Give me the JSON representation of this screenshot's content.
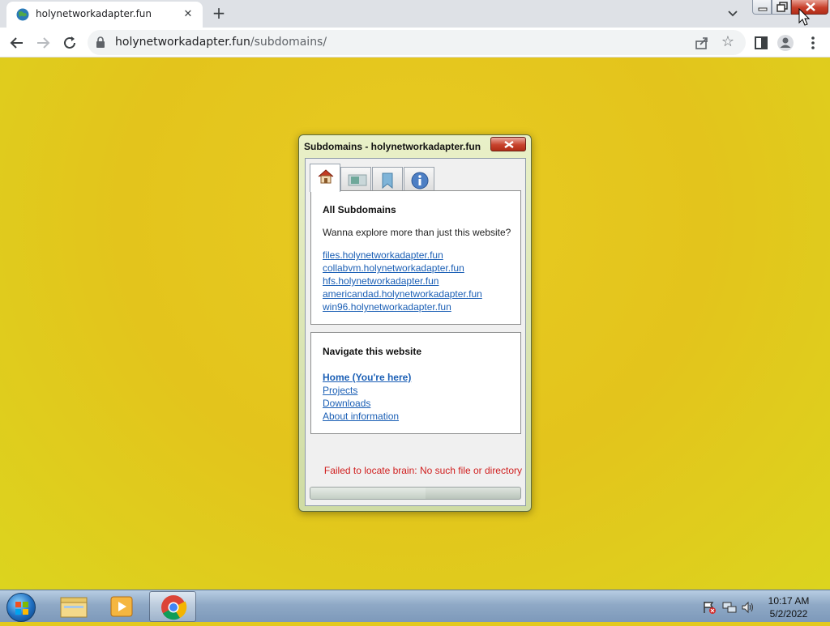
{
  "browser": {
    "tab_title": "holynetworkadapter.fun",
    "url_host": "holynetworkadapter.fun",
    "url_path": "/subdomains/"
  },
  "dialog": {
    "title": "Subdomains - holynetworkadapter.fun",
    "tabs": [
      "home-icon",
      "film-icon",
      "bookmark-icon",
      "info-icon"
    ],
    "subdomains_section": {
      "heading": "All Subdomains",
      "text": "Wanna explore more than just this website?",
      "links": [
        "files.holynetworkadapter.fun",
        "collabvm.holynetworkadapter.fun",
        "hfs.holynetworkadapter.fun",
        "americandad.holynetworkadapter.fun",
        "win96.holynetworkadapter.fun"
      ]
    },
    "navigate_section": {
      "heading": "Navigate this website",
      "links": [
        "Home (You're here)",
        "Projects",
        "Downloads",
        "About information"
      ]
    },
    "error": "Failed to locate brain: No such file or directory",
    "progress": 0.55
  },
  "taskbar": {
    "time": "10:17 AM",
    "date": "5/2/2022"
  },
  "colors": {
    "page_bg": "#e3c91e",
    "link": "#1b5fb5",
    "error": "#d01e1e"
  }
}
